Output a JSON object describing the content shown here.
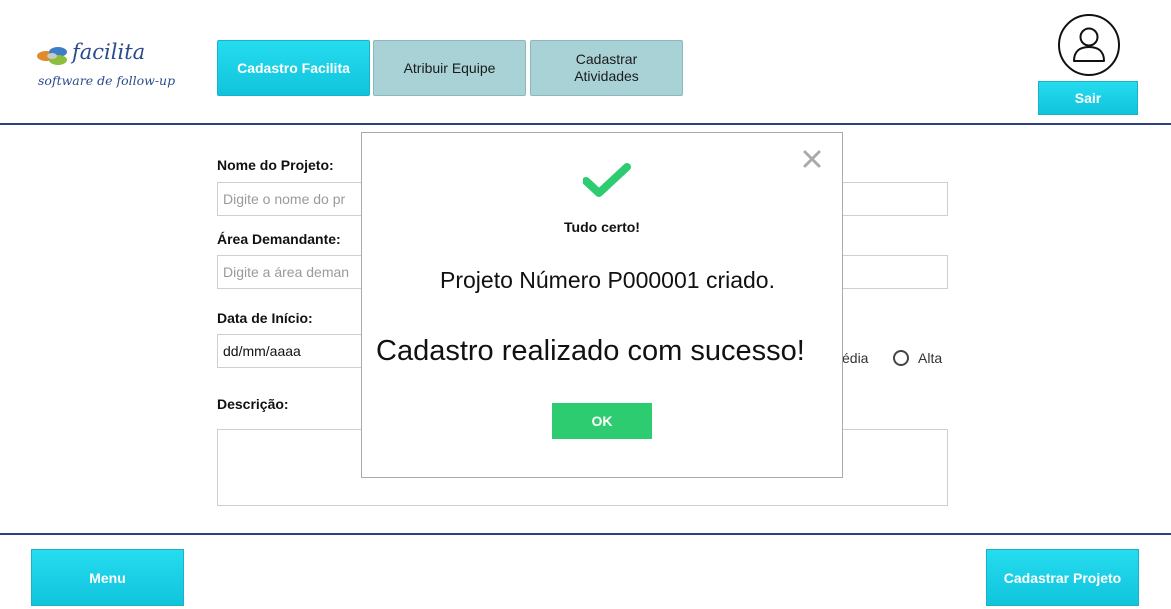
{
  "logo": {
    "word": "facilita",
    "tagline": "software de follow-up"
  },
  "tabs": [
    {
      "label": "Cadastro Facilita",
      "active": true
    },
    {
      "label": "Atribuir Equipe",
      "active": false
    },
    {
      "label": "Cadastrar\nAtividades",
      "active": false
    }
  ],
  "header": {
    "logout_label": "Sair",
    "avatar_icon": "user-icon"
  },
  "form": {
    "project_name_label": "Nome do Projeto:",
    "project_name_placeholder": "Digite o nome do pr",
    "area_label": "Área Demandante:",
    "area_placeholder": "Digite a área deman",
    "start_date_label": "Data de Início:",
    "start_date_value": "dd/mm/aaaa",
    "priority_partial_label": "édia",
    "priority_high_label": "Alta",
    "description_label": "Descrição:"
  },
  "footer": {
    "menu_label": "Menu",
    "submit_label": "Cadastrar Projeto"
  },
  "modal": {
    "title": "Tudo certo!",
    "message": "Projeto Número P000001 criado.",
    "headline": "Cadastro realizado com sucesso!",
    "ok_label": "OK",
    "icon": "check-icon",
    "close_icon": "close-icon"
  },
  "colors": {
    "accent": "#10c4dc",
    "tab_inactive": "#a8d2d6",
    "rule": "#2f3f7f",
    "success": "#2ecc71"
  }
}
